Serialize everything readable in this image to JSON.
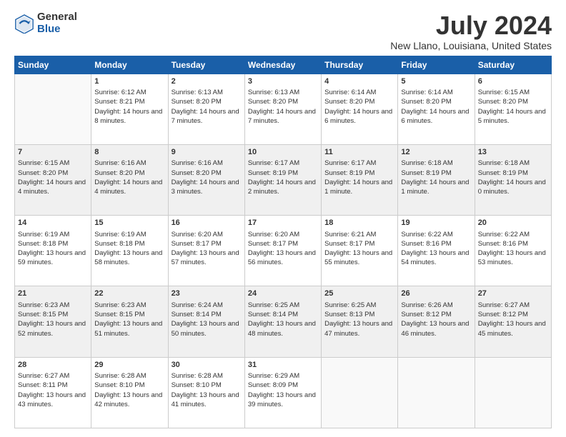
{
  "header": {
    "logo_general": "General",
    "logo_blue": "Blue",
    "title": "July 2024",
    "location": "New Llano, Louisiana, United States"
  },
  "days_of_week": [
    "Sunday",
    "Monday",
    "Tuesday",
    "Wednesday",
    "Thursday",
    "Friday",
    "Saturday"
  ],
  "weeks": [
    [
      {
        "day": "",
        "sunrise": "",
        "sunset": "",
        "daylight": ""
      },
      {
        "day": "1",
        "sunrise": "Sunrise: 6:12 AM",
        "sunset": "Sunset: 8:21 PM",
        "daylight": "Daylight: 14 hours and 8 minutes."
      },
      {
        "day": "2",
        "sunrise": "Sunrise: 6:13 AM",
        "sunset": "Sunset: 8:20 PM",
        "daylight": "Daylight: 14 hours and 7 minutes."
      },
      {
        "day": "3",
        "sunrise": "Sunrise: 6:13 AM",
        "sunset": "Sunset: 8:20 PM",
        "daylight": "Daylight: 14 hours and 7 minutes."
      },
      {
        "day": "4",
        "sunrise": "Sunrise: 6:14 AM",
        "sunset": "Sunset: 8:20 PM",
        "daylight": "Daylight: 14 hours and 6 minutes."
      },
      {
        "day": "5",
        "sunrise": "Sunrise: 6:14 AM",
        "sunset": "Sunset: 8:20 PM",
        "daylight": "Daylight: 14 hours and 6 minutes."
      },
      {
        "day": "6",
        "sunrise": "Sunrise: 6:15 AM",
        "sunset": "Sunset: 8:20 PM",
        "daylight": "Daylight: 14 hours and 5 minutes."
      }
    ],
    [
      {
        "day": "7",
        "sunrise": "Sunrise: 6:15 AM",
        "sunset": "Sunset: 8:20 PM",
        "daylight": "Daylight: 14 hours and 4 minutes."
      },
      {
        "day": "8",
        "sunrise": "Sunrise: 6:16 AM",
        "sunset": "Sunset: 8:20 PM",
        "daylight": "Daylight: 14 hours and 4 minutes."
      },
      {
        "day": "9",
        "sunrise": "Sunrise: 6:16 AM",
        "sunset": "Sunset: 8:20 PM",
        "daylight": "Daylight: 14 hours and 3 minutes."
      },
      {
        "day": "10",
        "sunrise": "Sunrise: 6:17 AM",
        "sunset": "Sunset: 8:19 PM",
        "daylight": "Daylight: 14 hours and 2 minutes."
      },
      {
        "day": "11",
        "sunrise": "Sunrise: 6:17 AM",
        "sunset": "Sunset: 8:19 PM",
        "daylight": "Daylight: 14 hours and 1 minute."
      },
      {
        "day": "12",
        "sunrise": "Sunrise: 6:18 AM",
        "sunset": "Sunset: 8:19 PM",
        "daylight": "Daylight: 14 hours and 1 minute."
      },
      {
        "day": "13",
        "sunrise": "Sunrise: 6:18 AM",
        "sunset": "Sunset: 8:19 PM",
        "daylight": "Daylight: 14 hours and 0 minutes."
      }
    ],
    [
      {
        "day": "14",
        "sunrise": "Sunrise: 6:19 AM",
        "sunset": "Sunset: 8:18 PM",
        "daylight": "Daylight: 13 hours and 59 minutes."
      },
      {
        "day": "15",
        "sunrise": "Sunrise: 6:19 AM",
        "sunset": "Sunset: 8:18 PM",
        "daylight": "Daylight: 13 hours and 58 minutes."
      },
      {
        "day": "16",
        "sunrise": "Sunrise: 6:20 AM",
        "sunset": "Sunset: 8:17 PM",
        "daylight": "Daylight: 13 hours and 57 minutes."
      },
      {
        "day": "17",
        "sunrise": "Sunrise: 6:20 AM",
        "sunset": "Sunset: 8:17 PM",
        "daylight": "Daylight: 13 hours and 56 minutes."
      },
      {
        "day": "18",
        "sunrise": "Sunrise: 6:21 AM",
        "sunset": "Sunset: 8:17 PM",
        "daylight": "Daylight: 13 hours and 55 minutes."
      },
      {
        "day": "19",
        "sunrise": "Sunrise: 6:22 AM",
        "sunset": "Sunset: 8:16 PM",
        "daylight": "Daylight: 13 hours and 54 minutes."
      },
      {
        "day": "20",
        "sunrise": "Sunrise: 6:22 AM",
        "sunset": "Sunset: 8:16 PM",
        "daylight": "Daylight: 13 hours and 53 minutes."
      }
    ],
    [
      {
        "day": "21",
        "sunrise": "Sunrise: 6:23 AM",
        "sunset": "Sunset: 8:15 PM",
        "daylight": "Daylight: 13 hours and 52 minutes."
      },
      {
        "day": "22",
        "sunrise": "Sunrise: 6:23 AM",
        "sunset": "Sunset: 8:15 PM",
        "daylight": "Daylight: 13 hours and 51 minutes."
      },
      {
        "day": "23",
        "sunrise": "Sunrise: 6:24 AM",
        "sunset": "Sunset: 8:14 PM",
        "daylight": "Daylight: 13 hours and 50 minutes."
      },
      {
        "day": "24",
        "sunrise": "Sunrise: 6:25 AM",
        "sunset": "Sunset: 8:14 PM",
        "daylight": "Daylight: 13 hours and 48 minutes."
      },
      {
        "day": "25",
        "sunrise": "Sunrise: 6:25 AM",
        "sunset": "Sunset: 8:13 PM",
        "daylight": "Daylight: 13 hours and 47 minutes."
      },
      {
        "day": "26",
        "sunrise": "Sunrise: 6:26 AM",
        "sunset": "Sunset: 8:12 PM",
        "daylight": "Daylight: 13 hours and 46 minutes."
      },
      {
        "day": "27",
        "sunrise": "Sunrise: 6:27 AM",
        "sunset": "Sunset: 8:12 PM",
        "daylight": "Daylight: 13 hours and 45 minutes."
      }
    ],
    [
      {
        "day": "28",
        "sunrise": "Sunrise: 6:27 AM",
        "sunset": "Sunset: 8:11 PM",
        "daylight": "Daylight: 13 hours and 43 minutes."
      },
      {
        "day": "29",
        "sunrise": "Sunrise: 6:28 AM",
        "sunset": "Sunset: 8:10 PM",
        "daylight": "Daylight: 13 hours and 42 minutes."
      },
      {
        "day": "30",
        "sunrise": "Sunrise: 6:28 AM",
        "sunset": "Sunset: 8:10 PM",
        "daylight": "Daylight: 13 hours and 41 minutes."
      },
      {
        "day": "31",
        "sunrise": "Sunrise: 6:29 AM",
        "sunset": "Sunset: 8:09 PM",
        "daylight": "Daylight: 13 hours and 39 minutes."
      },
      {
        "day": "",
        "sunrise": "",
        "sunset": "",
        "daylight": ""
      },
      {
        "day": "",
        "sunrise": "",
        "sunset": "",
        "daylight": ""
      },
      {
        "day": "",
        "sunrise": "",
        "sunset": "",
        "daylight": ""
      }
    ]
  ]
}
